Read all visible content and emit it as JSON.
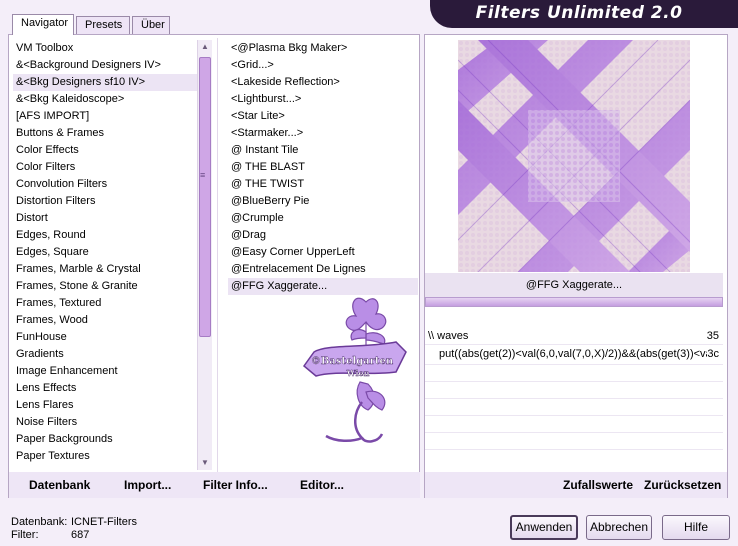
{
  "app": {
    "title": "Filters Unlimited 2.0"
  },
  "tabs": [
    "Navigator",
    "Presets",
    "Über"
  ],
  "categories": [
    "VM Toolbox",
    "&<Background Designers IV>",
    "&<Bkg Designers sf10 IV>",
    "&<Bkg Kaleidoscope>",
    "[AFS IMPORT]",
    "Buttons & Frames",
    "Color Effects",
    "Color Filters",
    "Convolution Filters",
    "Distortion Filters",
    "Distort",
    "Edges, Round",
    "Edges, Square",
    "Frames, Marble & Crystal",
    "Frames, Stone & Granite",
    "Frames, Textured",
    "Frames, Wood",
    "FunHouse",
    "Gradients",
    "Image Enhancement",
    "Lens Effects",
    "Lens Flares",
    "Noise Filters",
    "Paper Backgrounds",
    "Paper Textures"
  ],
  "selected_category": "&<Bkg Designers sf10 IV>",
  "filters": [
    "<@Plasma Bkg Maker>",
    "<Grid...>",
    "<Lakeside Reflection>",
    "<Lightburst...>",
    "<Star Lite>",
    "<Starmaker...>",
    "@ Instant Tile",
    "@ THE BLAST",
    "@ THE TWIST",
    "@BlueBerry Pie",
    "@Crumple",
    "@Drag",
    "@Easy Corner UpperLeft",
    "@Entrelacement De Lignes",
    "@FFG Xaggerate..."
  ],
  "selected_filter": "@FFG Xaggerate...",
  "watermark": {
    "text": "©Bastelgarten Wien"
  },
  "preview": {
    "filter_name": "@FFG Xaggerate...",
    "progress": 1.0
  },
  "params": [
    {
      "name": "\\\\ waves",
      "value": "35"
    }
  ],
  "formula": "put((abs(get(2))<val(6,0,val(7,0,X)/2))&&(abs(get(3))<val(6,0,",
  "formula_overflow": "3c",
  "bottom_links": {
    "database": "Datenbank",
    "import": "Import...",
    "filter_info": "Filter Info...",
    "editor": "Editor...",
    "random": "Zufallswerte",
    "reset": "Zurücksetzen"
  },
  "status": {
    "database_label": "Datenbank:",
    "database_value": "ICNET-Filters",
    "filter_label": "Filter:",
    "filter_value": "687"
  },
  "buttons": {
    "apply": "Anwenden",
    "cancel": "Abbrechen",
    "help": "Hilfe"
  },
  "colors": {
    "accent": "#b070e0",
    "title_bg": "#2a1a3a",
    "thumb": "#cfa6e6"
  }
}
